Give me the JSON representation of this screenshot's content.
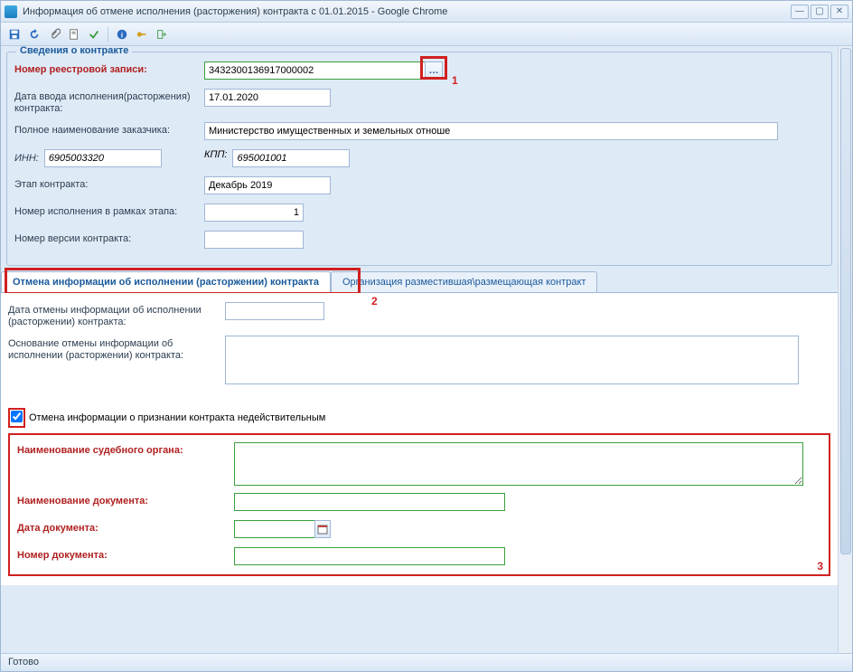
{
  "window": {
    "title": "Информация об отмене исполнения (расторжения) контракта с 01.01.2015 - Google Chrome"
  },
  "fieldset1": {
    "title": "Сведения о контракте",
    "reg_label": "Номер реестровой записи:",
    "reg_value": "3432300136917000002",
    "date_in_label": "Дата ввода исполнения(расторжения) контракта:",
    "date_in_value": "17.01.2020",
    "customer_label": "Полное наименование заказчика:",
    "customer_value": "Министерство имущественных и земельных отноше",
    "inn_label": "ИНН:",
    "inn_value": "6905003320",
    "kpp_label": "КПП:",
    "kpp_value": "695001001",
    "stage_label": "Этап контракта:",
    "stage_value": "Декабрь 2019",
    "exec_num_label": "Номер исполнения в рамках этапа:",
    "exec_num_value": "1",
    "ver_label": "Номер версии контракта:",
    "ver_value": ""
  },
  "tabs": {
    "t1": "Отмена информации об исполнении (расторжении) контракта",
    "t2": "Организация разместившая\\размещающая контракт"
  },
  "cancel": {
    "date_label": "Дата отмены информации об исполнении (расторжении) контракта:",
    "date_value": "",
    "basis_label": "Основание отмены информации об исполнении (расторжении) контракта:",
    "basis_value": "",
    "checkbox_label": "Отмена информации о признании контракта недействительным",
    "court_label": "Наименование судебного органа:",
    "doc_name_label": "Наименование документа:",
    "doc_date_label": "Дата документа:",
    "doc_num_label": "Номер документа:"
  },
  "markers": {
    "m1": "1",
    "m2": "2",
    "m3": "3"
  },
  "status": "Готово"
}
